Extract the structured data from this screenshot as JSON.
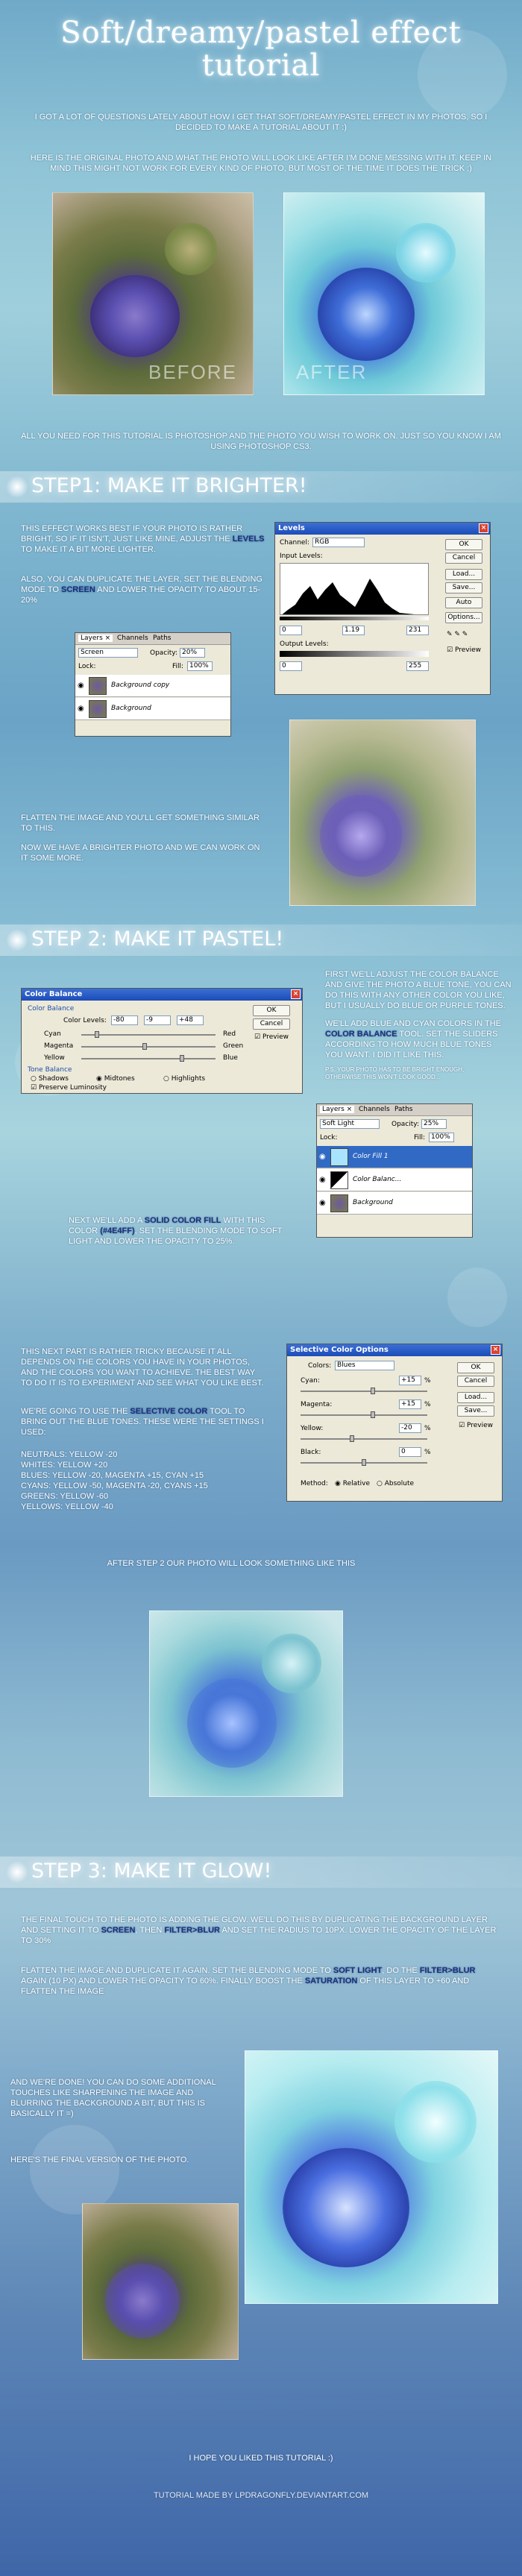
{
  "header": {
    "title_line1": "Soft/dreamy/pastel effect",
    "title_line2": "tutorial"
  },
  "intro": {
    "p1": "I got a lot of questions lately about how I get that soft/dreamy/pastel effect in my photos, so I decided to make a tutorial about it :)",
    "p2": "Here is the original photo and what the photo will look like after I'm done messing with it. Keep in mind this might not work for every kind of photo, but most of the time it does the trick ;)",
    "before_label": "BEFORE",
    "after_label": "AFTER",
    "p3": "All you need for this tutorial is photoshop and the photo you wish to work on. Just so you know I am using photoshop CS3."
  },
  "step1": {
    "title": "Step1: make it brighter!",
    "p1a": "This effect works best if your photo is rather bright, so if it isn't, just like mine, adjust the ",
    "p1_hl": "levels",
    "p1b": " to make it a bit more lighter.",
    "p2a": "Also, you can duplicate the layer, set the blending mode to ",
    "p2_hl": "screen",
    "p2b": " and lower the opacity to about 15-20%",
    "p3": "Flatten the image and you'll get something similar to this.",
    "p4": "Now we have a brighter photo and we can work on it some more.",
    "levels_window": {
      "title": "Levels",
      "channel_label": "Channel:",
      "channel_value": "RGB",
      "input_levels_label": "Input Levels:",
      "input_values": [
        "0",
        "1.19",
        "231"
      ],
      "output_levels_label": "Output Levels:",
      "output_values": [
        "0",
        "255"
      ],
      "buttons": [
        "OK",
        "Cancel",
        "Load...",
        "Save...",
        "Auto",
        "Options..."
      ],
      "preview_label": "Preview"
    },
    "layers_window": {
      "tabs": [
        "Layers ×",
        "Channels",
        "Paths"
      ],
      "mode": "Screen",
      "opacity_label": "Opacity:",
      "opacity_value": "20%",
      "lock_label": "Lock:",
      "fill_label": "Fill:",
      "fill_value": "100%",
      "layers": [
        "Background copy",
        "Background"
      ]
    }
  },
  "step2": {
    "title": "Step 2: make it pastel!",
    "p1a": "First we'll adjust the color balance and give the photo a blue tone, you can do this with any other color you like, but I usually do blue or purple tones.",
    "p2a": "We'll add blue and cyan colors in the ",
    "p2_hl": "color balance",
    "p2b": " tool. Set the sliders according to how much blue tones you want. I did it like this.",
    "note": "p.s. your photo has to be bright enough, otherwise this won't look good...",
    "p3a": "Next we'll add a ",
    "p3_hl": "solid color fill",
    "p3b": " with this color ",
    "p3_hex": "(#4E4FF)",
    "p3c": ", set the blending mode to soft light and lower the opacity to 25%.",
    "p4": "This next part is rather tricky because it all depends on the colors you have in your photos, and the colors you want to achieve. The best way to do it is to experiment and see what you like best.",
    "p5a": "We're going to use the ",
    "p5_hl": "selective color",
    "p5b": " tool to bring out the blue tones. These were the settings I used:",
    "settings": [
      "Neutrals: Yellow -20",
      "Whites: Yellow +20",
      "Blues: Yellow -20, Magenta +15, Cyan +15",
      "Cyans: Yellow -50, Magenta -20, Cyans +15",
      "Greens: Yellow -60",
      "Yellows: Yellow -40"
    ],
    "p6": "After step 2 our photo will look something like this",
    "color_balance": {
      "title": "Color Balance",
      "group1": "Color Balance",
      "levels_label": "Color Levels:",
      "levels_values": [
        "-80",
        "-9",
        "+48"
      ],
      "rows": [
        [
          "Cyan",
          "Red"
        ],
        [
          "Magenta",
          "Green"
        ],
        [
          "Yellow",
          "Blue"
        ]
      ],
      "group2": "Tone Balance",
      "tones": [
        "Shadows",
        "Midtones",
        "Highlights"
      ],
      "preserve": "Preserve Luminosity",
      "buttons": [
        "OK",
        "Cancel"
      ],
      "preview": "Preview"
    },
    "layers2": {
      "tabs": [
        "Layers ×",
        "Channels",
        "Paths"
      ],
      "mode": "Soft Light",
      "opacity_label": "Opacity:",
      "opacity_value": "25%",
      "lock_label": "Lock:",
      "fill_label": "Fill:",
      "fill_value": "100%",
      "layers": [
        "Color Fill 1",
        "Color Balanc...",
        "Background"
      ]
    },
    "selective_color": {
      "title": "Selective Color Options",
      "colors_label": "Colors:",
      "colors_value": "Blues",
      "rows": [
        [
          "Cyan:",
          "+15",
          "%"
        ],
        [
          "Magenta:",
          "+15",
          "%"
        ],
        [
          "Yellow:",
          "-20",
          "%"
        ],
        [
          "Black:",
          "0",
          "%"
        ]
      ],
      "method_label": "Method:",
      "methods": [
        "Relative",
        "Absolute"
      ],
      "buttons": [
        "OK",
        "Cancel",
        "Load...",
        "Save..."
      ],
      "preview": "Preview"
    }
  },
  "step3": {
    "title": "Step 3: make it glow!",
    "p1a": "The final touch to the photo is adding the glow. We'll do this by duplicating the background layer and setting it to ",
    "p1_hl1": "screen",
    "p1b": ", then ",
    "p1_hl2": "filter>blur",
    "p1c": " and set the radius to 10px. Lower the opacity of the layer to 30%",
    "p2a": "Flatten the image and duplicate it again. Set the blending mode to ",
    "p2_hl1": "soft light",
    "p2b": ", do the ",
    "p2_hl2": "filter>blur",
    "p2c": " again (10 px) and lower the opacity to 60%. Finally boost the ",
    "p2_hl3": "saturation",
    "p2d": " of this layer to +60 and flatten the image",
    "p3": "And we're done! You can do some additional touches like sharpening the image and blurring the background a bit, but this is basically it =)",
    "p4": "Here's the final version of the photo."
  },
  "footer": {
    "thanks": "I hope you liked this tutorial :)",
    "credit": "Tutorial made by LPDragonfly.deviantart.com"
  },
  "colors": {
    "highlight": "#1a2f80",
    "flower_purple": "#5a4fb0",
    "flower_blue": "#3f6ed8"
  }
}
